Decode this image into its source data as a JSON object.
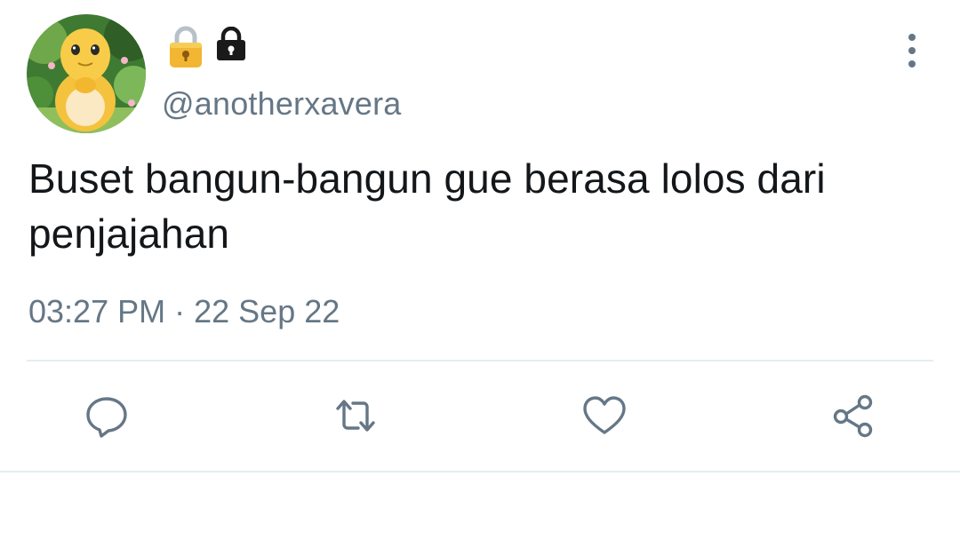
{
  "tweet": {
    "handle": "@anotherxavera",
    "name_emojis": [
      "lock-emoji",
      "lock-icon"
    ],
    "text": "Buset bangun-bangun gue berasa lolos dari penjajahan",
    "time": "03:27 PM",
    "separator": "·",
    "date": "22 Sep 22"
  },
  "actions": [
    {
      "icon": "reply-icon"
    },
    {
      "icon": "retweet-icon"
    },
    {
      "icon": "like-icon"
    },
    {
      "icon": "share-icon"
    }
  ],
  "colors": {
    "text": "#14171a",
    "secondary": "#657786",
    "divider": "#e6ecf0",
    "avatar_bg": "#3b6b2c",
    "mascot": "#f6c94a"
  }
}
